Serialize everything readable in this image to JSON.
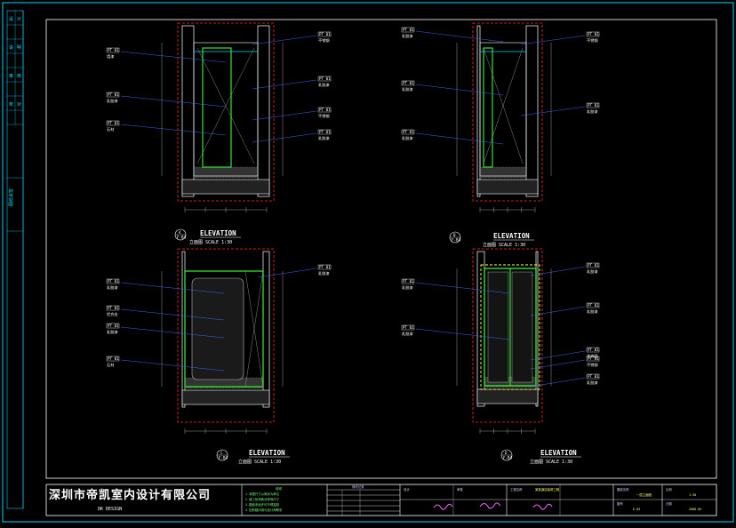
{
  "company": {
    "name_cn": "深圳市帝凯室内设计有限公司",
    "name_en": "DK  DESIGN"
  },
  "side_strip": {
    "cells": [
      "设",
      "计",
      "说",
      "明",
      "审",
      "核",
      "校",
      "对"
    ],
    "bottom": "图纸会签"
  },
  "elevations": [
    {
      "id": "A",
      "title": "ELEVATION",
      "ref": "F-B4",
      "scale_text": "立面图  SCALE  1:30",
      "tags": [
        {
          "code": "PT 01",
          "text": "墙漆"
        },
        {
          "code": "PT 01",
          "text": "乳胶漆"
        },
        {
          "code": "PT 01",
          "text": "石材"
        },
        {
          "code": "PT 01",
          "text": "不锈钢"
        },
        {
          "code": "PT 01",
          "text": "乳胶漆"
        },
        {
          "code": "PT 01",
          "text": "不锈钢"
        },
        {
          "code": "PT 01",
          "text": "乳胶漆"
        }
      ]
    },
    {
      "id": "B",
      "title": "ELEVATION",
      "ref": "F-B4",
      "scale_text": "立面图  SCALE  1:30",
      "tags": [
        {
          "code": "PT 01",
          "text": "乳胶漆"
        },
        {
          "code": "PT 01",
          "text": "乳胶漆"
        },
        {
          "code": "PT 01",
          "text": "乳胶漆"
        },
        {
          "code": "PT 01",
          "text": "不锈钢"
        },
        {
          "code": "PT 01",
          "text": "乳胶漆"
        }
      ]
    },
    {
      "id": "C",
      "title": "ELEVATION",
      "ref": "F-B4",
      "scale_text": "立面图  SCALE  1:30",
      "tags": [
        {
          "code": "PT 01",
          "text": "乳胶漆"
        },
        {
          "code": "PT 01",
          "text": "铝合金"
        },
        {
          "code": "PT 01",
          "text": "乳胶漆"
        },
        {
          "code": "PT 01",
          "text": "石材"
        },
        {
          "code": "PT 01",
          "text": "乳胶漆"
        }
      ]
    },
    {
      "id": "D",
      "title": "ELEVATION",
      "ref": "F-B4",
      "scale_text": "立面图  SCALE  1:30",
      "tags": [
        {
          "code": "PT 01",
          "text": "乳胶漆"
        },
        {
          "code": "PT 01",
          "text": "乳胶漆"
        },
        {
          "code": "PT 01",
          "text": "乳胶漆"
        },
        {
          "code": "PT 01",
          "text": "乳胶漆"
        },
        {
          "code": "PT 01",
          "text": "木饰面"
        },
        {
          "code": "PT 01",
          "text": "不锈钢"
        },
        {
          "code": "PT 01",
          "text": "乳胶漆"
        }
      ]
    }
  ],
  "title_block": {
    "notes_head": "说明",
    "notes_lines": [
      "1.本图尺寸以毫米为单位",
      "2.施工前请核对现场尺寸",
      "3.图纸未经许可不得复制",
      "4.如有疑问请与设计师联系"
    ],
    "revision_head": "修改记录",
    "project_label": "工程名称",
    "project_name": "某某酒店装修工程",
    "drawing_label": "图纸名称",
    "drawing_name": "一层立面图",
    "designer_label": "设计",
    "checker_label": "审核",
    "scale_label": "比例",
    "scale_value": "1:30",
    "sheet_label": "图号",
    "sheet_value": "E-03",
    "date_label": "日期",
    "date_value": "2008.05"
  },
  "colors": {
    "frame": "#00d7ff",
    "wall": "#ffffff",
    "dashed": "#ff2a2a",
    "accent": "#2fe82f",
    "door": "#ffff55",
    "leader": "#3a66ff"
  }
}
